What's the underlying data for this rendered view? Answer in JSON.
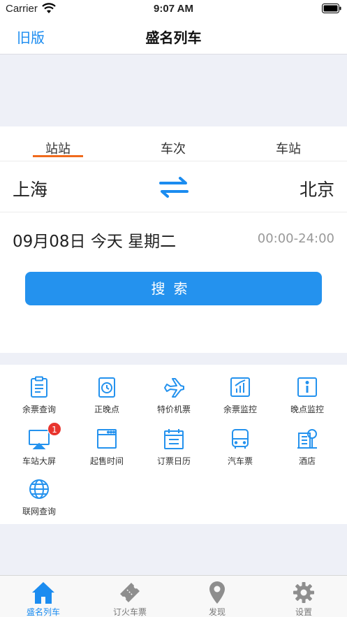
{
  "status": {
    "carrier": "Carrier",
    "time": "9:07 AM"
  },
  "nav": {
    "back": "旧版",
    "title": "盛名列车"
  },
  "tabs": [
    {
      "label": "站站"
    },
    {
      "label": "车次"
    },
    {
      "label": "车站"
    }
  ],
  "query": {
    "from": "上海",
    "to": "北京",
    "date": "09月08日 今天 星期二",
    "time_range": "00:00-24:00",
    "search_label": "搜索"
  },
  "grid": [
    {
      "label": "余票查询",
      "icon": "clipboard-icon"
    },
    {
      "label": "正晚点",
      "icon": "clock-icon"
    },
    {
      "label": "特价机票",
      "icon": "airplane-icon"
    },
    {
      "label": "余票监控",
      "icon": "chart-icon"
    },
    {
      "label": "晚点监控",
      "icon": "info-icon"
    },
    {
      "label": "车站大屏",
      "icon": "screen-icon",
      "badge": "1"
    },
    {
      "label": "起售时间",
      "icon": "window-icon"
    },
    {
      "label": "订票日历",
      "icon": "calendar-icon"
    },
    {
      "label": "汽车票",
      "icon": "bus-icon"
    },
    {
      "label": "酒店",
      "icon": "hotel-icon"
    },
    {
      "label": "联网查询",
      "icon": "globe-icon"
    }
  ],
  "tabbar": [
    {
      "label": "盛名列车",
      "icon": "home-icon"
    },
    {
      "label": "订火车票",
      "icon": "ticket-icon"
    },
    {
      "label": "发现",
      "icon": "location-pin-icon"
    },
    {
      "label": "设置",
      "icon": "gear-icon"
    }
  ],
  "colors": {
    "accent": "#1b8cf0",
    "tab_underline": "#f06a1c",
    "button": "#2492ee",
    "badge": "#e8352e"
  }
}
